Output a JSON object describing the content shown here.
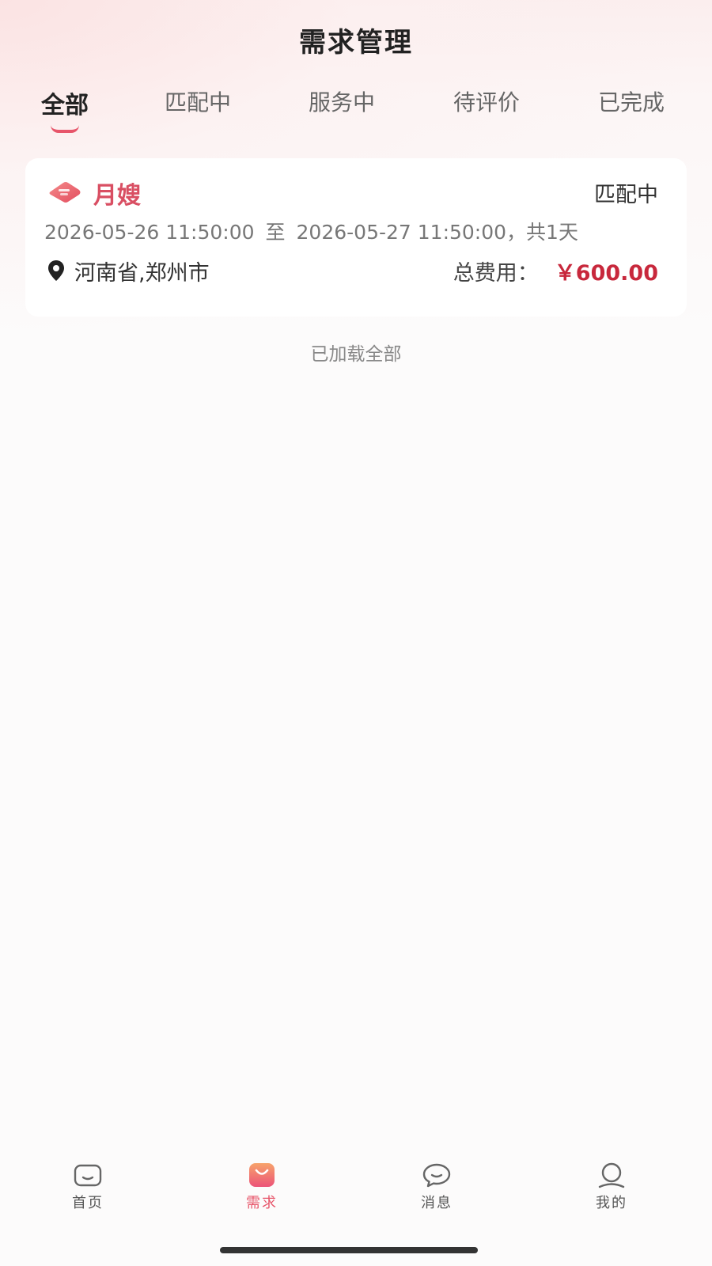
{
  "header": {
    "title": "需求管理"
  },
  "tabs": [
    {
      "label": "全部",
      "active": true
    },
    {
      "label": "匹配中",
      "active": false
    },
    {
      "label": "服务中",
      "active": false
    },
    {
      "label": "待评价",
      "active": false
    },
    {
      "label": "已完成",
      "active": false
    }
  ],
  "orders": [
    {
      "service": "月嫂",
      "service_icon": "tag-icon",
      "status": "匹配中",
      "start": "2026-05-26 11:50:00",
      "to": "至",
      "end": "2026-05-27 11:50:00，共1天",
      "location": "河南省,郑州市",
      "fee_label": "总费用：",
      "fee_value": "￥600.00"
    }
  ],
  "list_footer": "已加载全部",
  "tabbar": [
    {
      "label": "首页",
      "icon": "home-icon",
      "active": false
    },
    {
      "label": "需求",
      "icon": "demand-bag-icon",
      "active": true
    },
    {
      "label": "消息",
      "icon": "message-icon",
      "active": false
    },
    {
      "label": "我的",
      "icon": "profile-icon",
      "active": false
    }
  ],
  "colors": {
    "accent": "#e7556a",
    "price": "#c8283c"
  }
}
